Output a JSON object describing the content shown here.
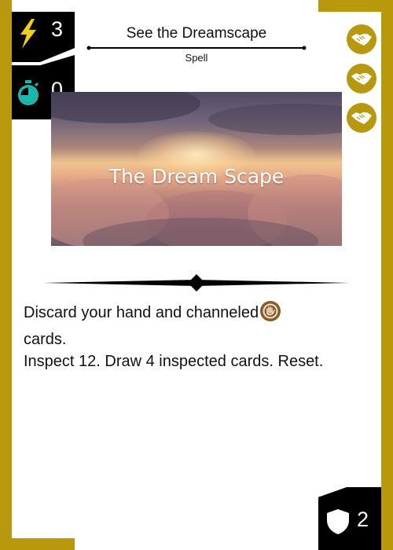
{
  "card": {
    "title": "See the Dreamscape",
    "type": "Spell",
    "cost": "3",
    "speed": "0",
    "defense": "2",
    "art_caption": "The Dream Scape",
    "rules_line1": "Discard your hand and channeled",
    "rules_line2": "cards.",
    "rules_line3": "Inspect 12. Draw 4 inspected cards. Reset."
  },
  "icons": {
    "cost": "lightning-icon",
    "speed": "stopwatch-icon",
    "defense": "shield-icon",
    "tokens": [
      "handshake-icon",
      "handshake-icon",
      "handshake-icon"
    ],
    "channel": "channel-hand-icon"
  },
  "colors": {
    "frame": "#b8980d",
    "badge": "#000000",
    "cost_icon": "#f2cd1a",
    "speed_icon": "#1fb6ad",
    "channel_icon": "#8a5a2b"
  }
}
